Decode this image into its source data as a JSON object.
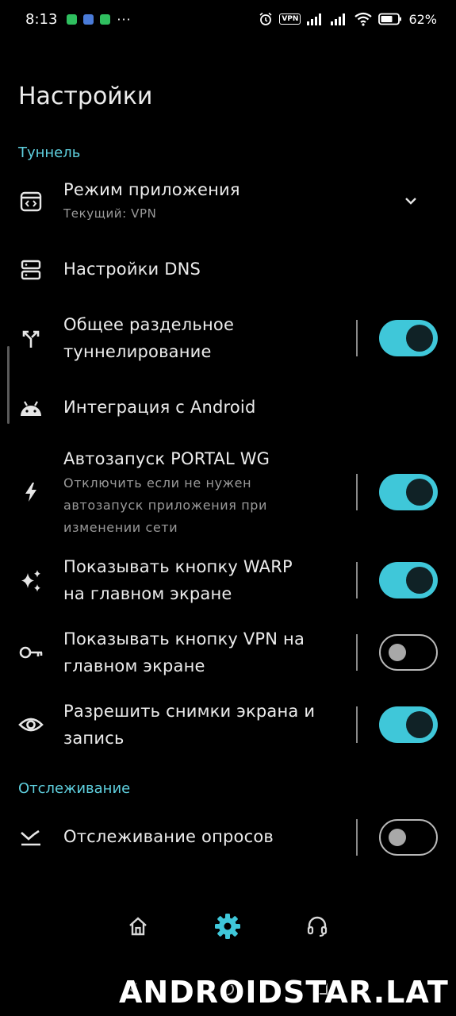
{
  "status_bar": {
    "time": "8:13",
    "dots": "···",
    "vpn_label": "VPN",
    "battery_percent": "62%"
  },
  "page": {
    "title": "Настройки"
  },
  "sections": {
    "tunnel": "Туннель",
    "tracking": "Отслеживание"
  },
  "rows": {
    "app_mode": {
      "title": "Режим приложения",
      "subtitle": "Текущий: VPN"
    },
    "dns": {
      "title": "Настройки DNS"
    },
    "split_tunnel": {
      "title_line1": "Общее раздельное",
      "title_line2": "туннелирование",
      "enabled": true
    },
    "android": {
      "title": "Интеграция с Android"
    },
    "autostart": {
      "title": "Автозапуск PORTAL WG",
      "sub_line1": "Отключить если не нужен",
      "sub_line2": "автозапуск приложения при",
      "sub_line3": "изменении сети",
      "enabled": true
    },
    "warp_button": {
      "title_line1": "Показывать кнопку WARP",
      "title_line2": "на главном экране",
      "enabled": true
    },
    "vpn_button": {
      "title_line1": "Показывать кнопку VPN на",
      "title_line2": "главном экране",
      "enabled": false
    },
    "screenshots": {
      "title_line1": "Разрешить снимки экрана и",
      "title_line2": "запись",
      "enabled": true
    },
    "polling": {
      "title": "Отслеживание опросов",
      "enabled": false
    }
  },
  "colors": {
    "accent": "#3fc7d9",
    "section_header": "#5fd0df",
    "background": "#000000"
  },
  "bottom_nav": {
    "items": [
      "home-icon",
      "gear-icon",
      "headset-icon"
    ],
    "active": "gear-icon"
  },
  "watermark": "ANDROIDSTAR.LAT"
}
